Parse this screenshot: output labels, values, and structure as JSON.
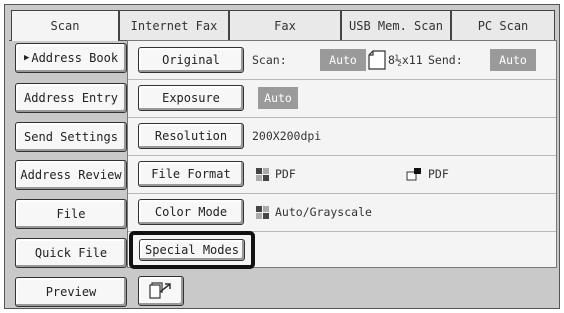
{
  "tabs": [
    "Scan",
    "Internet Fax",
    "Fax",
    "USB Mem. Scan",
    "PC Scan"
  ],
  "active_tab": "Scan",
  "sidebar": {
    "items": [
      {
        "label": "Address Book",
        "arrow": "▶"
      },
      {
        "label": "Address Entry"
      },
      {
        "label": "Send Settings"
      },
      {
        "label": "Address Review"
      },
      {
        "label": "File"
      },
      {
        "label": "Quick File"
      },
      {
        "label": "Preview"
      }
    ]
  },
  "settings": {
    "original": {
      "button": "Original",
      "scan_label": "Scan:",
      "scan_value": "Auto",
      "size": "8½x11",
      "send_label": "Send:",
      "send_value": "Auto"
    },
    "exposure": {
      "button": "Exposure",
      "value": "Auto"
    },
    "resolution": {
      "button": "Resolution",
      "value": "200X200dpi"
    },
    "file_format": {
      "button": "File Format",
      "value_bw": "PDF",
      "value_color": "PDF"
    },
    "color_mode": {
      "button": "Color Mode",
      "value": "Auto/Grayscale"
    },
    "special_modes": {
      "button": "Special Modes"
    }
  }
}
